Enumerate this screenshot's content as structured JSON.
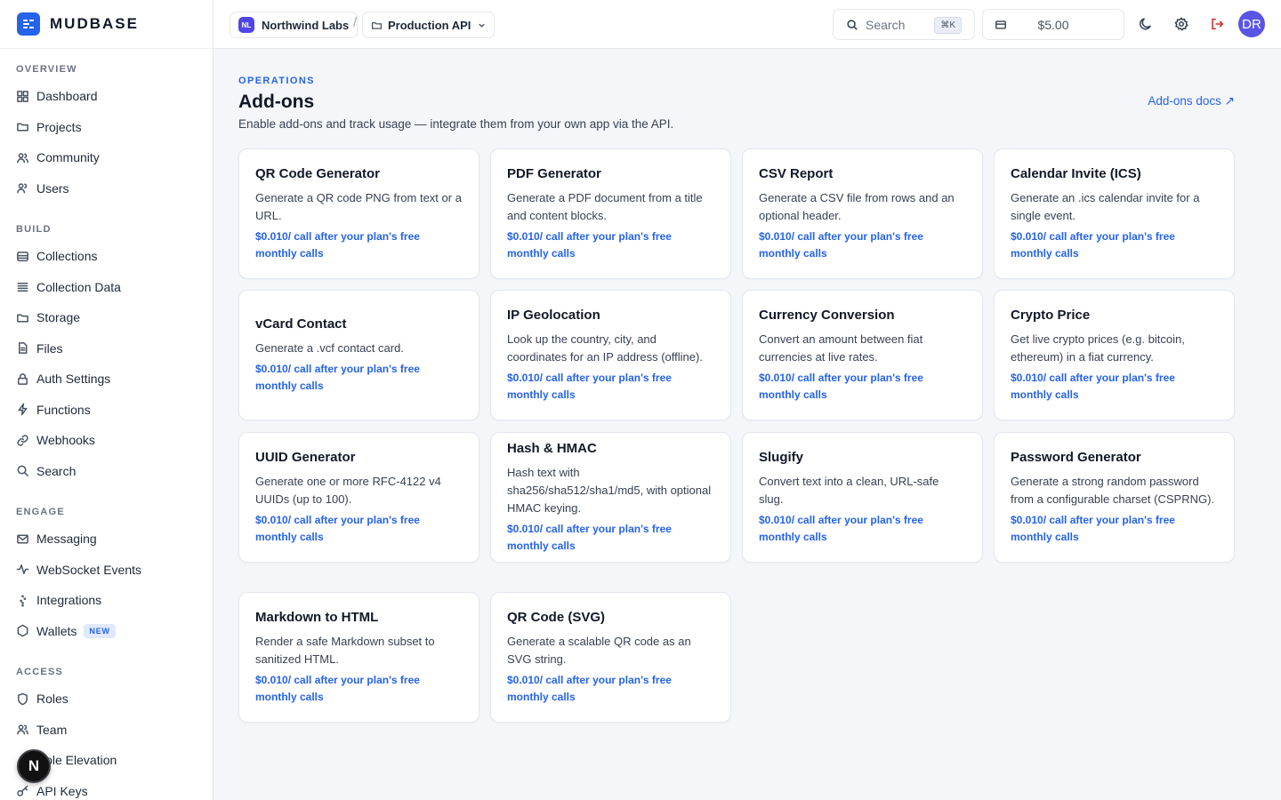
{
  "brand": {
    "name": "MUDBASE"
  },
  "sidebar": {
    "sections": [
      {
        "title": "OVERVIEW",
        "items": [
          {
            "label": "Dashboard",
            "icon": "grid-icon"
          },
          {
            "label": "Projects",
            "icon": "folder-icon"
          },
          {
            "label": "Community",
            "icon": "users-icon"
          },
          {
            "label": "Users",
            "icon": "user-icon"
          }
        ]
      },
      {
        "title": "BUILD",
        "items": [
          {
            "label": "Collections",
            "icon": "database-icon"
          },
          {
            "label": "Collection Data",
            "icon": "list-icon"
          },
          {
            "label": "Storage",
            "icon": "folder-icon"
          },
          {
            "label": "Files",
            "icon": "file-icon"
          },
          {
            "label": "Auth Settings",
            "icon": "lock-icon"
          },
          {
            "label": "Functions",
            "icon": "bolt-icon"
          },
          {
            "label": "Webhooks",
            "icon": "link-icon"
          },
          {
            "label": "Search",
            "icon": "search-icon"
          }
        ]
      },
      {
        "title": "ENGAGE",
        "items": [
          {
            "label": "Messaging",
            "icon": "mail-icon"
          },
          {
            "label": "WebSocket Events",
            "icon": "activity-icon"
          },
          {
            "label": "Integrations",
            "icon": "plug-icon"
          },
          {
            "label": "Wallets",
            "icon": "hexagon-icon",
            "badge": "NEW"
          }
        ]
      },
      {
        "title": "ACCESS",
        "items": [
          {
            "label": "Roles",
            "icon": "shield-icon"
          },
          {
            "label": "Team",
            "icon": "users-icon"
          },
          {
            "label": "Role Elevation",
            "icon": "arrow-up-icon"
          },
          {
            "label": "API Keys",
            "icon": "key-icon"
          }
        ]
      }
    ],
    "floating_button": "N"
  },
  "topbar": {
    "org": {
      "initials": "NL",
      "name": "Northwind Labs"
    },
    "separator": "/",
    "project": {
      "name": "Production API"
    },
    "search": {
      "placeholder": "Search",
      "shortcut": "⌘K"
    },
    "credit": "$5.00",
    "user_initials": "DR"
  },
  "page": {
    "eyebrow": "OPERATIONS",
    "title": "Add-ons",
    "subtitle": "Enable add-ons and track usage — integrate them from your own app via the API.",
    "docs_link": "Add-ons docs ↗"
  },
  "addons": [
    {
      "title": "QR Code Generator",
      "desc": "Generate a QR code PNG from text or a URL.",
      "price": "$0.010/ call after your plan's free monthly calls"
    },
    {
      "title": "PDF Generator",
      "desc": "Generate a PDF document from a title and content blocks.",
      "price": "$0.010/ call after your plan's free monthly calls"
    },
    {
      "title": "CSV Report",
      "desc": "Generate a CSV file from rows and an optional header.",
      "price": "$0.010/ call after your plan's free monthly calls"
    },
    {
      "title": "Calendar Invite (ICS)",
      "desc": "Generate an .ics calendar invite for a single event.",
      "price": "$0.010/ call after your plan's free monthly calls"
    },
    {
      "title": "vCard Contact",
      "desc": "Generate a .vcf contact card.",
      "price": "$0.010/ call after your plan's free monthly calls"
    },
    {
      "title": "IP Geolocation",
      "desc": "Look up the country, city, and coordinates for an IP address (offline).",
      "price": "$0.010/ call after your plan's free monthly calls"
    },
    {
      "title": "Currency Conversion",
      "desc": "Convert an amount between fiat currencies at live rates.",
      "price": "$0.010/ call after your plan's free monthly calls"
    },
    {
      "title": "Crypto Price",
      "desc": "Get live crypto prices (e.g. bitcoin, ethereum) in a fiat currency.",
      "price": "$0.010/ call after your plan's free monthly calls"
    },
    {
      "title": "UUID Generator",
      "desc": "Generate one or more RFC-4122 v4 UUIDs (up to 100).",
      "price": "$0.010/ call after your plan's free monthly calls"
    },
    {
      "title": "Hash & HMAC",
      "desc": "Hash text with sha256/sha512/sha1/md5, with optional HMAC keying.",
      "price": "$0.010/ call after your plan's free monthly calls"
    },
    {
      "title": "Slugify",
      "desc": "Convert text into a clean, URL-safe slug.",
      "price": "$0.010/ call after your plan's free monthly calls"
    },
    {
      "title": "Password Generator",
      "desc": "Generate a strong random password from a configurable charset (CSPRNG).",
      "price": "$0.010/ call after your plan's free monthly calls"
    },
    {
      "title": "Markdown to HTML",
      "desc": "Render a safe Markdown subset to sanitized HTML.",
      "price": "$0.010/ call after your plan's free monthly calls"
    },
    {
      "title": "QR Code (SVG)",
      "desc": "Generate a scalable QR code as an SVG string.",
      "price": "$0.010/ call after your plan's free monthly calls"
    }
  ]
}
